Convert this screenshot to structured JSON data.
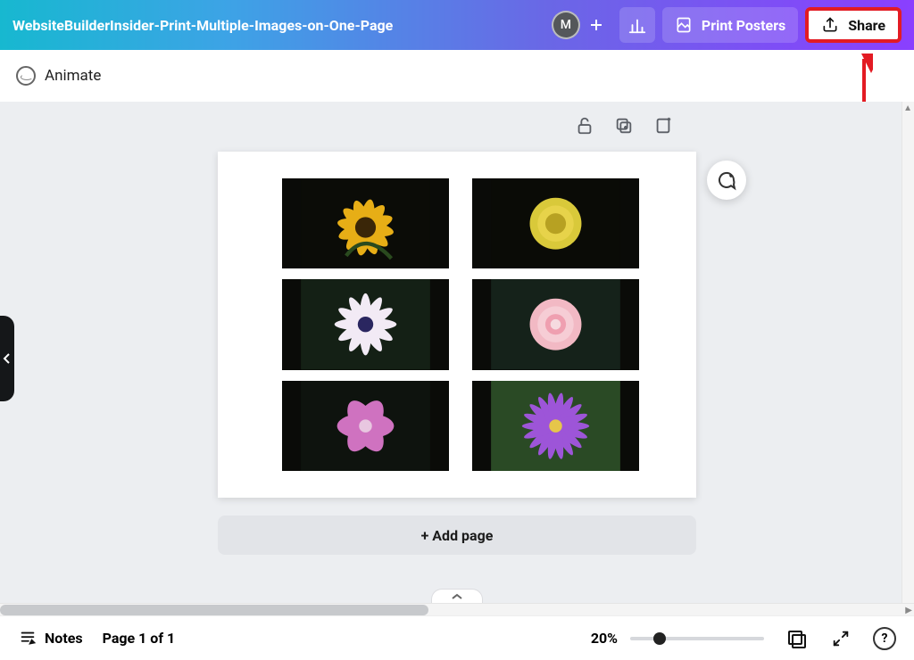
{
  "header": {
    "title": "WebsiteBuilderInsider-Print-Multiple-Images-on-One-Page",
    "avatar_initial": "M",
    "print_posters_label": "Print Posters",
    "share_label": "Share"
  },
  "secondary_bar": {
    "animate_label": "Animate"
  },
  "canvas": {
    "add_page_label": "+ Add page",
    "images": [
      {
        "name": "yellow-sunflower"
      },
      {
        "name": "yellow-dahlia"
      },
      {
        "name": "white-daisy"
      },
      {
        "name": "pink-rose"
      },
      {
        "name": "pink-flower"
      },
      {
        "name": "purple-waterlily"
      }
    ]
  },
  "footer": {
    "notes_label": "Notes",
    "page_indicator": "Page 1 of 1",
    "zoom_label": "20%",
    "help_label": "?"
  }
}
